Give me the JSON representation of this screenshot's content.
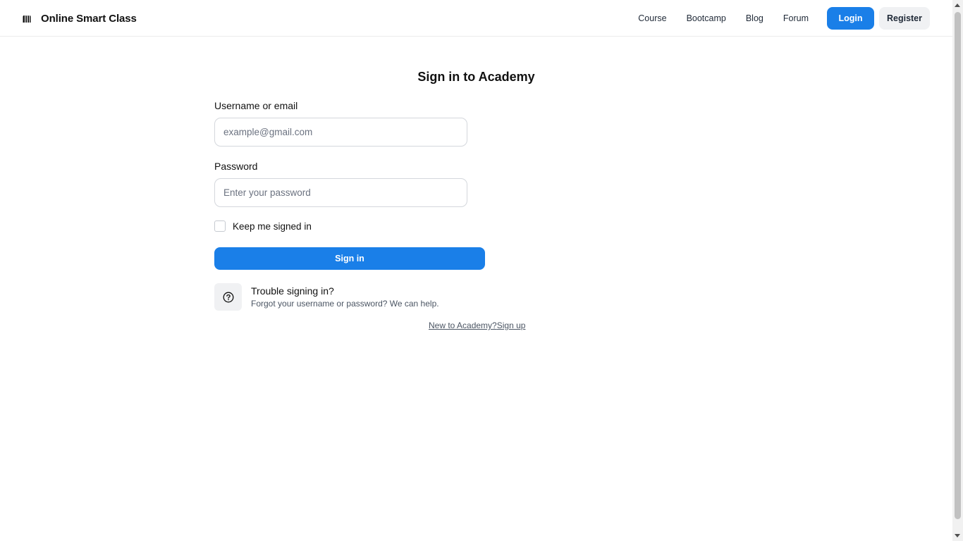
{
  "header": {
    "brand_name": "Online Smart Class",
    "brand_icon": "brand-logo-icon",
    "nav": [
      {
        "label": "Course"
      },
      {
        "label": "Bootcamp"
      },
      {
        "label": "Blog"
      },
      {
        "label": "Forum"
      }
    ],
    "login_label": "Login",
    "register_label": "Register"
  },
  "form": {
    "title": "Sign in to Academy",
    "username_label": "Username or email",
    "username_placeholder": "example@gmail.com",
    "username_value": "",
    "password_label": "Password",
    "password_placeholder": "Enter your password",
    "password_value": "",
    "remember_label": "Keep me signed in",
    "remember_checked": false,
    "submit_label": "Sign in"
  },
  "trouble": {
    "icon": "help-circle-icon",
    "title": "Trouble signing in?",
    "subtitle": "Forgot your username or password? We can help."
  },
  "signup": {
    "prompt": "New to Academy?",
    "link": "Sign up"
  },
  "colors": {
    "primary": "#1a7fe8",
    "secondary_button": "#f0f1f3",
    "border": "#d4d7dc"
  }
}
